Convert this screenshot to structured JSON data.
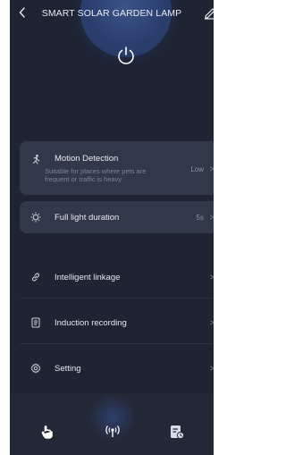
{
  "header": {
    "title": "SMART SOLAR GARDEN LAMP",
    "back_icon": "chevron-left-icon",
    "edit_icon": "edit-icon"
  },
  "power": {
    "icon": "power-icon"
  },
  "menu": {
    "motion_detection": {
      "label": "Motion Detection",
      "description": "Suitable for places where pets are frequent or traffic is heavy",
      "value": "Low",
      "chevron": ">",
      "icon": "motion-icon"
    },
    "full_light_duration": {
      "label": "Full light duration",
      "value": "5s",
      "chevron": ">",
      "icon": "brightness-icon"
    },
    "intelligent_linkage": {
      "label": "Intelligent linkage",
      "chevron": ">",
      "icon": "link-icon"
    },
    "induction_recording": {
      "label": "Induction recording",
      "chevron": ">",
      "icon": "document-icon"
    },
    "setting": {
      "label": "Setting",
      "chevron": ">",
      "icon": "gear-icon"
    }
  },
  "nav": {
    "items": [
      "hand-icon",
      "signal-icon",
      "schedule-icon"
    ],
    "active": "signal-icon"
  },
  "colors": {
    "background": "#1f2432",
    "card": "#31384a",
    "accent": "#2b3f6f",
    "text": "#e6e8ee"
  }
}
